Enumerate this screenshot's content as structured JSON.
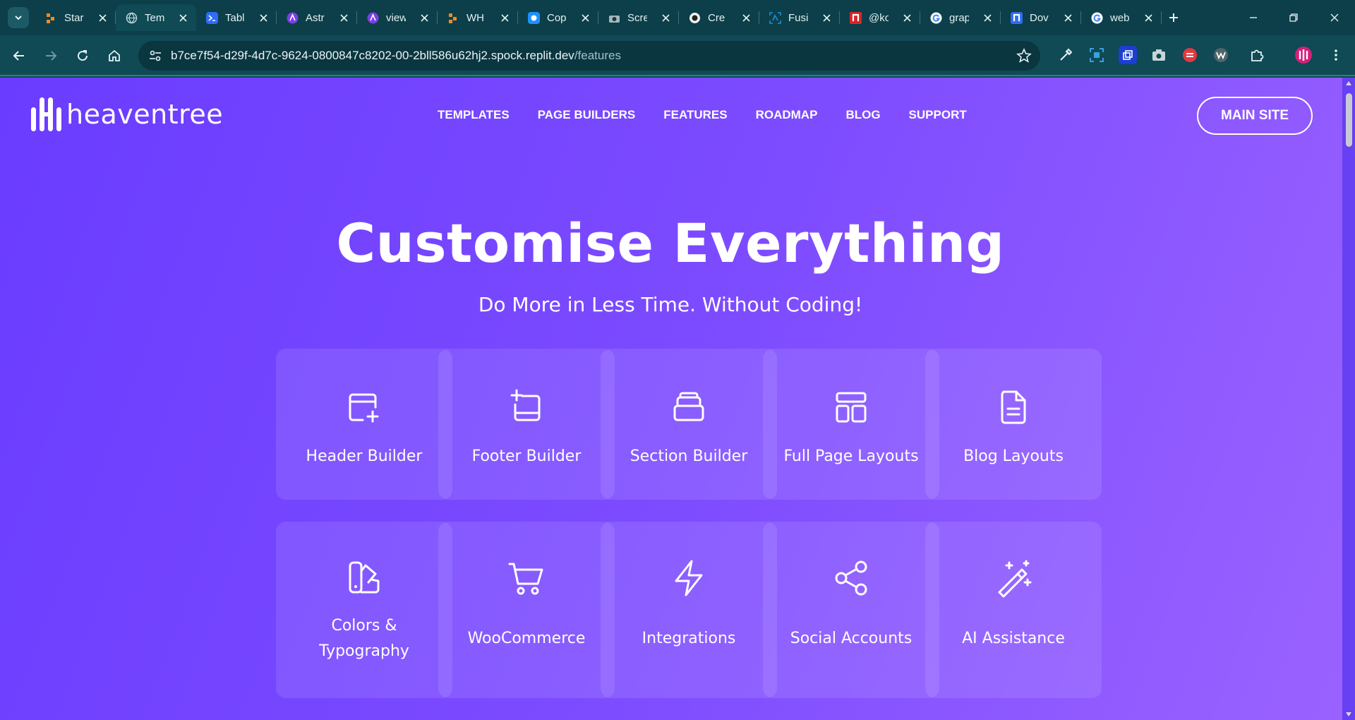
{
  "browser": {
    "tabs": [
      {
        "title": "Star",
        "favicon": "orange-blocks-icon",
        "color": "#f08a24"
      },
      {
        "title": "Tem",
        "favicon": "globe-icon",
        "color": "#8ab4bb",
        "active": true
      },
      {
        "title": "Tabl",
        "favicon": "terminal-icon",
        "color": "#2f6df6"
      },
      {
        "title": "Astr",
        "favicon": "astro-icon",
        "color": "#7b3fe4"
      },
      {
        "title": "view",
        "favicon": "astro-icon",
        "color": "#7b3fe4"
      },
      {
        "title": "WH",
        "favicon": "orange-blocks-icon",
        "color": "#f08a24"
      },
      {
        "title": "Cop",
        "favicon": "copilot-icon",
        "color": "#1e90ff"
      },
      {
        "title": "Scre",
        "favicon": "camera-icon",
        "color": "#9aa7ab"
      },
      {
        "title": "Cre",
        "favicon": "brain-icon",
        "color": "#222222"
      },
      {
        "title": "Fusi",
        "favicon": "fusion-icon",
        "color": "#1f8fd6"
      },
      {
        "title": "@ko",
        "favicon": "n-red-icon",
        "color": "#d6262b"
      },
      {
        "title": "grap",
        "favicon": "google-icon",
        "color": "#ffffff"
      },
      {
        "title": "Dov",
        "favicon": "n-blue-icon",
        "color": "#2f6df6"
      },
      {
        "title": "web",
        "favicon": "google-icon",
        "color": "#ffffff"
      }
    ],
    "url_host": "b7ce7f54-d29f-4d7c-9624-0800847c8202-00-2bll586u62hj2.spock.replit.dev",
    "url_path": "/features"
  },
  "site": {
    "logo_text": "heaventree",
    "nav": [
      "TEMPLATES",
      "PAGE BUILDERS",
      "FEATURES",
      "ROADMAP",
      "BLOG",
      "SUPPORT"
    ],
    "cta": "MAIN SITE",
    "title": "Customise Everything",
    "subtitle": "Do More in Less Time. Without Coding!",
    "features": [
      {
        "label": "Header Builder",
        "icon": "browser-add-icon"
      },
      {
        "label": "Footer Builder",
        "icon": "footer-add-icon"
      },
      {
        "label": "Section Builder",
        "icon": "stack-icon"
      },
      {
        "label": "Full Page Layouts",
        "icon": "layout-icon"
      },
      {
        "label": "Blog Layouts",
        "icon": "document-icon"
      },
      {
        "label": "Colors & Typography",
        "icon": "swatch-icon"
      },
      {
        "label": "WooCommerce",
        "icon": "cart-icon"
      },
      {
        "label": "Integrations",
        "icon": "bolt-icon"
      },
      {
        "label": "Social Accounts",
        "icon": "share-icon"
      },
      {
        "label": "AI Assistance",
        "icon": "magic-wand-icon"
      }
    ]
  },
  "colors": {
    "chrome_dark": "#0c3f49",
    "chrome": "#0f4a55",
    "page_start": "#6a3cff",
    "page_end": "#9a62ff"
  }
}
